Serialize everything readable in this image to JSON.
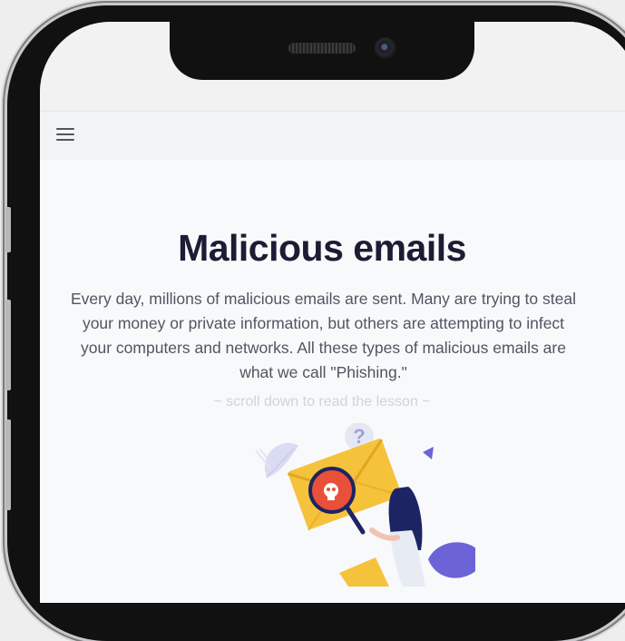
{
  "header": {
    "menu_icon": "hamburger-menu-icon"
  },
  "lesson": {
    "title": "Malicious emails",
    "intro": "Every day, millions of malicious emails are sent. Many are trying to steal your money or private information, but others are attempting to infect your computers and networks. All these types of malicious emails are what we call \"Phishing.\"",
    "scroll_hint": "~ scroll down to read the lesson ~"
  },
  "illustration": {
    "icons": [
      "envelope-icon",
      "magnifying-glass-icon",
      "skull-icon",
      "question-mark-icon",
      "person-icon",
      "leaf-icon"
    ],
    "colors": {
      "envelope": "#f5c33b",
      "magnifier": "#e8503a",
      "accent": "#6b63d6",
      "hair": "#1d2464"
    },
    "question_mark": "?"
  }
}
